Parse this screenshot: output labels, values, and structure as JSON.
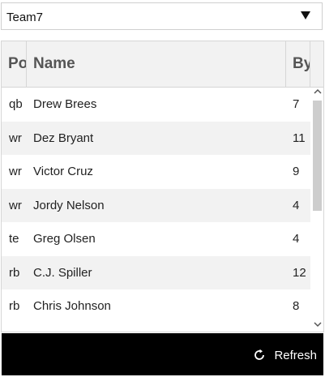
{
  "team_select": {
    "value": "Team7",
    "arrow_icon": "dropdown-arrow-icon"
  },
  "grid": {
    "columns": [
      "Po",
      "Name",
      "By"
    ],
    "rows": [
      {
        "pos": "qb",
        "name": "Drew Brees",
        "bye": "7"
      },
      {
        "pos": "wr",
        "name": "Dez Bryant",
        "bye": "11"
      },
      {
        "pos": "wr",
        "name": "Victor Cruz",
        "bye": "9"
      },
      {
        "pos": "wr",
        "name": "Jordy Nelson",
        "bye": "4"
      },
      {
        "pos": "te",
        "name": "Greg Olsen",
        "bye": "4"
      },
      {
        "pos": "rb",
        "name": "C.J. Spiller",
        "bye": "12"
      },
      {
        "pos": "rb",
        "name": "Chris Johnson",
        "bye": "8"
      }
    ]
  },
  "footer": {
    "refresh_label": "Refresh",
    "refresh_icon": "refresh-icon"
  },
  "colors": {
    "header_bg": "#f2f2f2",
    "alt_row_bg": "#f2f2f2",
    "footer_bg": "#000000",
    "footer_text": "#ffffff"
  }
}
